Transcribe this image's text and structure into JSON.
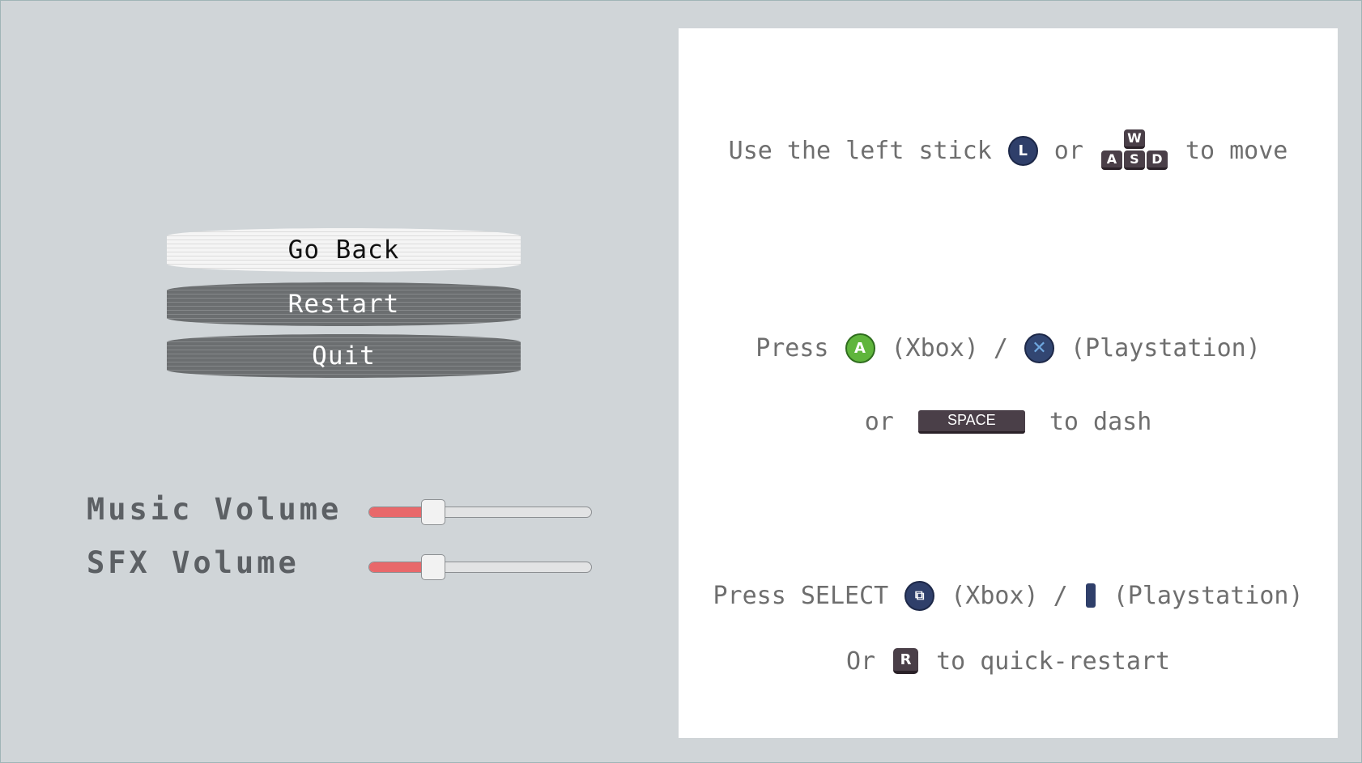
{
  "menu": {
    "go_back": "Go Back",
    "restart": "Restart",
    "quit": "Quit"
  },
  "volume": {
    "music_label": "Music Volume",
    "music_level": 0.29,
    "sfx_label": "SFX Volume",
    "sfx_level": 0.29
  },
  "controls": {
    "move": {
      "prefix": "Use the left stick",
      "stick_glyph": "L",
      "or": "or",
      "keys": [
        "W",
        "A",
        "S",
        "D"
      ],
      "suffix": "to move"
    },
    "dash": {
      "press": "Press",
      "xbox_glyph": "A",
      "xbox_label": "(Xbox) /",
      "ps_glyph": "✕",
      "ps_label": "(Playstation)",
      "or": "or",
      "space_key": "SPACE",
      "suffix": "to dash"
    },
    "restart": {
      "press": "Press SELECT",
      "select_glyph": "⧉",
      "xbox_label": "(Xbox) /",
      "ps_label": "(Playstation)",
      "or": "Or",
      "r_key": "R",
      "suffix": "to quick-restart"
    }
  },
  "colors": {
    "background": "#d0d5d8",
    "slider_fill": "#e8686a",
    "button_active": "#f5f5f5",
    "button_inactive": "#6b6e70"
  }
}
